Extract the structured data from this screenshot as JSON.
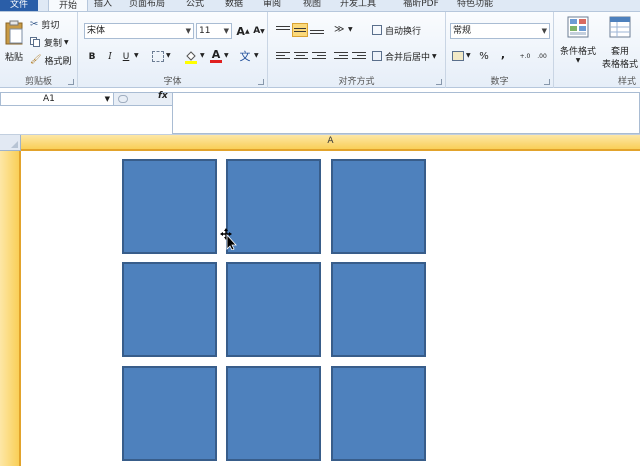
{
  "tabs": [
    {
      "label": "文件"
    },
    {
      "label": "开始"
    },
    {
      "label": "插入"
    },
    {
      "label": "页面布局"
    },
    {
      "label": "公式"
    },
    {
      "label": "数据"
    },
    {
      "label": "审阅"
    },
    {
      "label": "视图"
    },
    {
      "label": "开发工具"
    },
    {
      "label": "福昕PDF"
    },
    {
      "label": "特色功能"
    }
  ],
  "clipboard": {
    "paste": "粘贴",
    "cut": "剪切",
    "copy": "复制",
    "format_painter": "格式刷",
    "group_label": "剪贴板"
  },
  "font": {
    "name": "宋体",
    "size": "11",
    "grow": "A",
    "shrink": "A",
    "bold": "B",
    "italic": "I",
    "underline": "U",
    "font_color_letter": "A",
    "phonetic": "文",
    "group_label": "字体"
  },
  "alignment": {
    "wrap_text": "自动换行",
    "merge_center": "合并后居中",
    "group_label": "对齐方式"
  },
  "number": {
    "format": "常规",
    "percent": "%",
    "comma": ",",
    "increase_decimal": "+.0",
    "decrease_decimal": ".00",
    "group_label": "数字"
  },
  "styles": {
    "conditional_format": "条件格式",
    "apply_table_1": "套用",
    "apply_table_2": "表格格式",
    "group_label": "样式"
  },
  "formula_bar": {
    "name_box": "A1",
    "fx": "fx"
  },
  "grid": {
    "column_a": "A"
  },
  "colors": {
    "shape_fill": "#4e81bd",
    "shape_border": "#385d8a",
    "selected_header": "#f9cf58"
  }
}
